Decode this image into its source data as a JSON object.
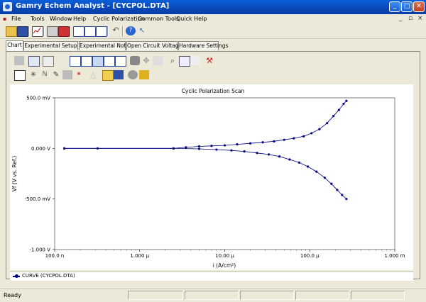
{
  "window": {
    "title": "Gamry Echem Analyst - [CYCPOL.DTA]"
  },
  "menu": [
    "File",
    "Tools",
    "Window",
    "Help",
    "Cyclic Polarization",
    "Common Tools",
    "Quick Help"
  ],
  "tabs": [
    "Chart",
    "Experimental Setup",
    "Experimental Notes",
    "Open Circuit Voltage",
    "Hardware Settings"
  ],
  "toolbar_icons": [
    "open-icon",
    "save-icon",
    "chart-icon",
    "print-icon",
    "export-icon",
    "layout-icon",
    "layout-icon",
    "layout-icon",
    "undo-icon",
    "help-icon",
    "help-pointer-icon"
  ],
  "chart_data": {
    "type": "scatter",
    "title": "Cyclic Polarization Scan",
    "xlabel": "i (A/cm²)",
    "ylabel": "Vf (V vs. Ref.)",
    "xscale": "log",
    "xlim": [
      1e-07,
      0.001
    ],
    "ylim": [
      -1.0,
      0.5
    ],
    "x_ticks": [
      "100.0 n",
      "1.000 µ",
      "10.00 µ",
      "100.0 µ",
      "1.000 m"
    ],
    "y_ticks": [
      "500.0 mV",
      "0.000 V",
      "-500.0 mV",
      "-1.000 V"
    ],
    "series": [
      {
        "name": "CURVE (CYCPOL.DTA)",
        "color": "#000080",
        "x": [
          1.3e-07,
          3.2e-07,
          2.5e-06,
          3.5e-06,
          5e-06,
          7e-06,
          1e-05,
          1.4e-05,
          2e-05,
          2.8e-05,
          3.8e-05,
          5e-05,
          6.5e-05,
          8.5e-05,
          0.000105,
          0.00013,
          0.00016,
          0.00019,
          0.00022,
          0.00025,
          0.00027
        ],
        "y": [
          0.0,
          0.0,
          0.0,
          0.01,
          0.02,
          0.025,
          0.03,
          0.04,
          0.05,
          0.06,
          0.07,
          0.085,
          0.1,
          0.12,
          0.15,
          0.19,
          0.25,
          0.32,
          0.38,
          0.44,
          0.47
        ]
      },
      {
        "name": "",
        "color": "#000080",
        "x": [
          0.00027,
          0.00024,
          0.00021,
          0.00018,
          0.00015,
          0.00012,
          9.5e-05,
          7.5e-05,
          5.8e-05,
          4.4e-05,
          3.3e-05,
          2.4e-05,
          1.7e-05,
          1.2e-05,
          8e-06,
          5e-06,
          2.5e-06,
          1.3e-07
        ],
        "y": [
          -0.5,
          -0.46,
          -0.41,
          -0.35,
          -0.29,
          -0.23,
          -0.18,
          -0.14,
          -0.11,
          -0.08,
          -0.06,
          -0.045,
          -0.03,
          -0.02,
          -0.012,
          -0.005,
          0.0,
          0.0
        ]
      }
    ],
    "legend": [
      "CURVE (CYCPOL.DTA)"
    ]
  },
  "status": {
    "text": "Ready"
  }
}
